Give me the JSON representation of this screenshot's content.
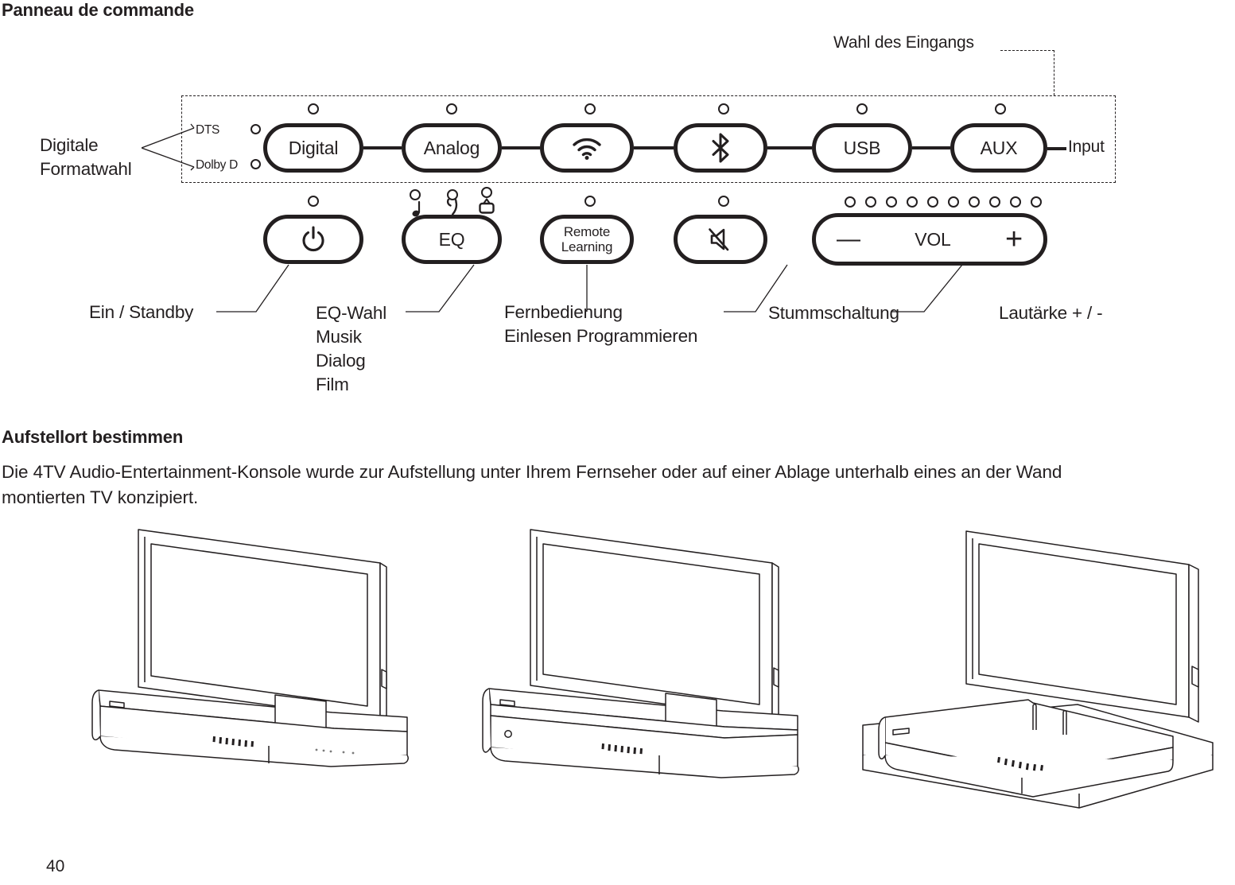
{
  "page": {
    "heading": "Panneau de commande",
    "number": "40"
  },
  "panel": {
    "input_group_label": "Input",
    "input_selection_label": "Wahl des Eingangs",
    "digital_format_label": "Digitale\nFormatwahl",
    "format_leds": [
      {
        "label": "DTS",
        "name": "dts-indicator"
      },
      {
        "label": "Dolby D",
        "name": "dolby-d-indicator"
      }
    ],
    "input_buttons": [
      {
        "label": "Digital",
        "icon": "none",
        "name": "digital-button"
      },
      {
        "label": "Analog",
        "icon": "none",
        "name": "analog-button"
      },
      {
        "label": "",
        "icon": "wifi-icon",
        "name": "wifi-button"
      },
      {
        "label": "",
        "icon": "bluetooth-icon",
        "name": "bluetooth-button"
      },
      {
        "label": "USB",
        "icon": "none",
        "name": "usb-button"
      },
      {
        "label": "AUX",
        "icon": "none",
        "name": "aux-button"
      }
    ],
    "control_buttons": [
      {
        "label": "",
        "icon": "power-icon",
        "name": "power-button"
      },
      {
        "label": "EQ",
        "icon": "none",
        "name": "eq-button"
      },
      {
        "label": "Remote\nLearning",
        "icon": "none",
        "name": "remote-learning-button"
      },
      {
        "label": "",
        "icon": "mute-icon",
        "name": "mute-button"
      }
    ],
    "volume": {
      "minus": "—",
      "label": "VOL",
      "plus": "+",
      "led_count": 10
    },
    "eq_indicators": [
      {
        "icon": "music-note-icon",
        "name": "eq-music-indicator"
      },
      {
        "icon": "dialog-icon",
        "name": "eq-dialog-indicator"
      },
      {
        "icon": "tv-film-icon",
        "name": "eq-film-icon"
      }
    ],
    "callouts": [
      {
        "text": "Ein / Standby",
        "name": "callout-power"
      },
      {
        "text": "EQ-Wahl\nMusik\nDialog\nFilm",
        "name": "callout-eq"
      },
      {
        "text": "Fernbedienung\nEinlesen Programmieren",
        "name": "callout-remote"
      },
      {
        "text": "Stummschaltung",
        "name": "callout-mute"
      },
      {
        "text": "Lautärke + / -",
        "name": "callout-volume"
      }
    ]
  },
  "placement": {
    "heading": "Aufstellort bestimmen",
    "text": "Die 4TV Audio-Entertainment-Konsole wurde zur Aufstellung unter Ihrem Fernseher oder auf einer Ablage unterhalb eines an der Wand montierten TV konzipiert."
  },
  "illustrations": [
    {
      "name": "tv-on-console-front",
      "caption": ""
    },
    {
      "name": "tv-on-console-angled",
      "caption": ""
    },
    {
      "name": "tv-wall-mounted-console-on-shelf",
      "caption": ""
    }
  ]
}
